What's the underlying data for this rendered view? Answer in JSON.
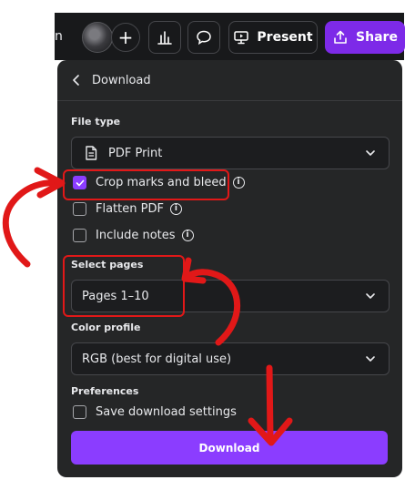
{
  "toolbar": {
    "fragment_text": "n",
    "plus_label": "+",
    "present_label": "Present",
    "share_label": "Share"
  },
  "panel": {
    "title": "Download",
    "file_type": {
      "label": "File type",
      "value": "PDF Print"
    },
    "options": [
      {
        "label": "Crop marks and bleed",
        "checked": true
      },
      {
        "label": "Flatten PDF",
        "checked": false
      },
      {
        "label": "Include notes",
        "checked": false
      }
    ],
    "select_pages": {
      "label": "Select pages",
      "value": "Pages 1–10"
    },
    "color_profile": {
      "label": "Color profile",
      "value": "RGB (best for digital use)"
    },
    "preferences": {
      "label": "Preferences",
      "save_settings": {
        "label": "Save download settings",
        "checked": false
      }
    },
    "download_label": "Download"
  },
  "colors": {
    "accent": "#8b3dff",
    "panel_bg": "#252627",
    "annotation": "#e11818"
  }
}
